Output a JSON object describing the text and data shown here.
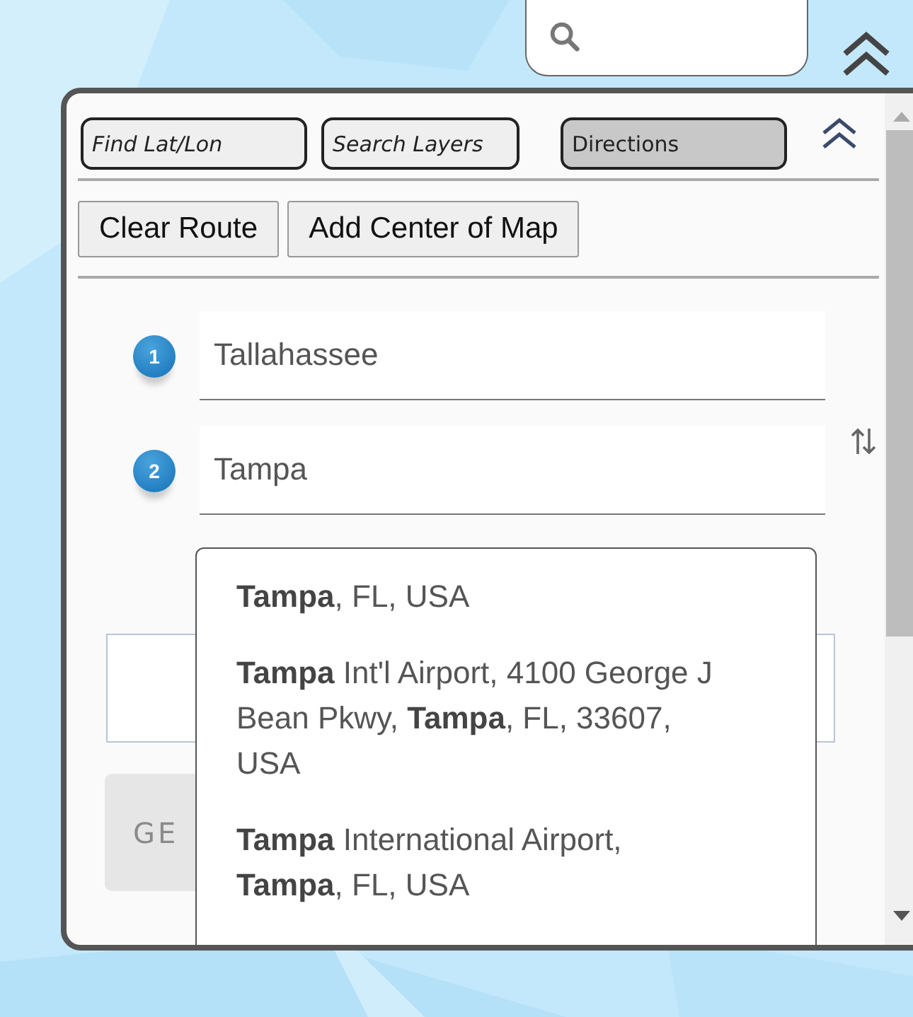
{
  "tabs": [
    {
      "label": "Find Lat/Lon",
      "selected": false
    },
    {
      "label": "Search Layers",
      "selected": false
    },
    {
      "label": "Directions",
      "selected": true
    }
  ],
  "actions": [
    "Clear Route",
    "Add Center of Map"
  ],
  "stops": [
    {
      "number": "1",
      "value": "Tallahassee"
    },
    {
      "number": "2",
      "value": "Tampa"
    }
  ],
  "suggestions": [
    "**Tampa**, FL, USA",
    "**Tampa** Int'l Airport, 4100 George J Bean Pkwy, **Tampa**, FL, 33607, USA",
    "**Tampa** International Airport, **Tampa**, FL, USA"
  ],
  "get_button": {
    "label": "GE",
    "disabled": true
  }
}
